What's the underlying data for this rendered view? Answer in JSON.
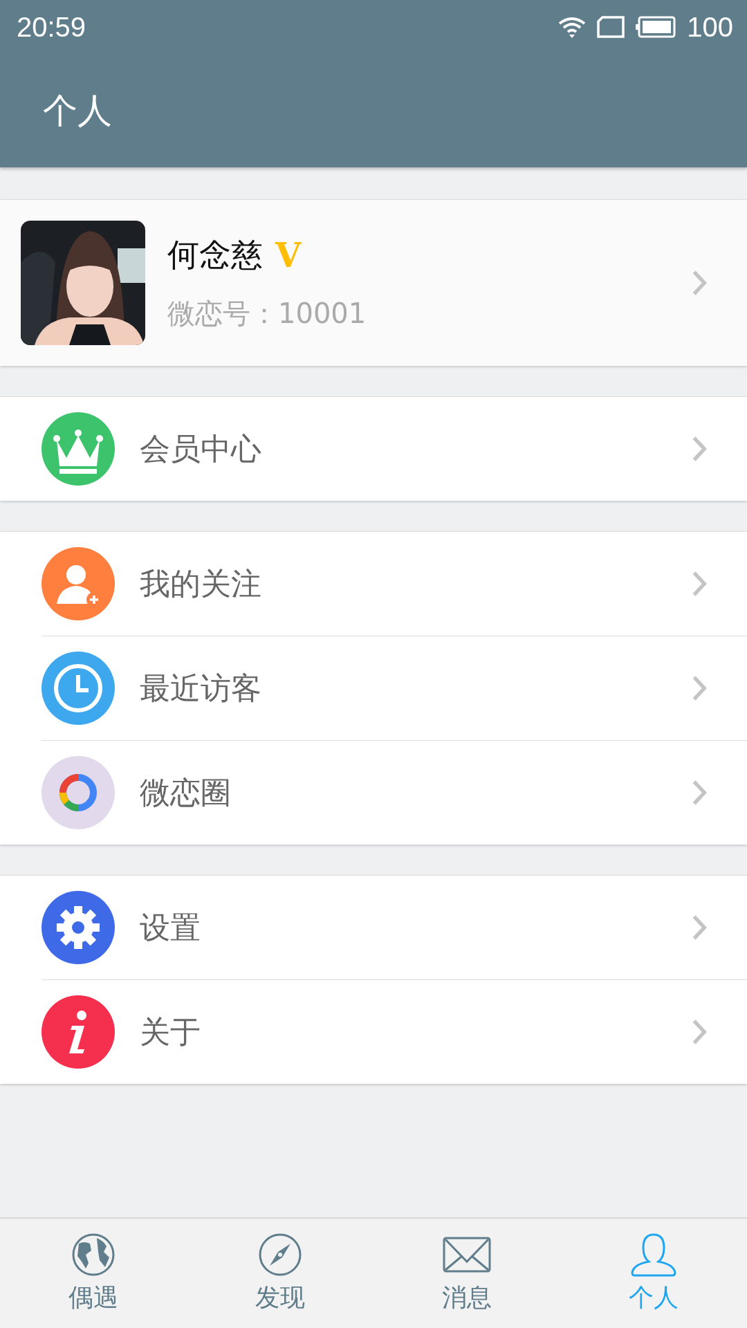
{
  "status_bar": {
    "time": "20:59",
    "battery": "100"
  },
  "app_bar": {
    "title": "个人"
  },
  "profile": {
    "name": "何念慈",
    "badge": "V",
    "account": "微恋号：10001"
  },
  "sections": [
    {
      "items": [
        {
          "label": "会员中心",
          "kind": "crown",
          "color": "#3cc36c"
        }
      ]
    },
    {
      "items": [
        {
          "label": "我的关注",
          "kind": "person-add",
          "color": "#ff7f3f"
        },
        {
          "label": "最近访客",
          "kind": "clock",
          "color": "#3ea8ef"
        },
        {
          "label": "微恋圈",
          "kind": "ring",
          "color": "#e2d9ec"
        }
      ]
    },
    {
      "items": [
        {
          "label": "设置",
          "kind": "gear",
          "color": "#3e6ae8"
        },
        {
          "label": "关于",
          "kind": "info",
          "color": "#f5304e"
        }
      ]
    }
  ],
  "tabs": [
    {
      "label": "偶遇",
      "kind": "globe",
      "selected": false
    },
    {
      "label": "发现",
      "kind": "compass",
      "selected": false
    },
    {
      "label": "消息",
      "kind": "mail",
      "selected": false
    },
    {
      "label": "个人",
      "kind": "person",
      "selected": true
    }
  ]
}
